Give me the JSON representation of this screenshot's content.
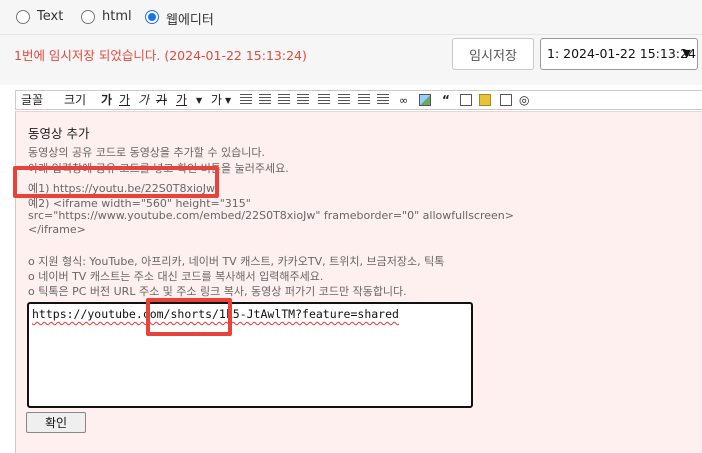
{
  "mode": {
    "options": [
      {
        "label": "Text",
        "checked": false
      },
      {
        "label": "html",
        "checked": false
      },
      {
        "label": "웹에디터",
        "checked": true
      }
    ]
  },
  "status": {
    "message": "1번에 임시저장 되었습니다. (2024-01-22 15:13:24)",
    "temp_save_label": "임시저장",
    "draft_selected": "1: 2024-01-22 15:13:24"
  },
  "toolbar": {
    "font_label": "글꼴",
    "size_label": "크기",
    "bold": "가",
    "underline": "가",
    "italic": "가",
    "strike": "가",
    "font_color": "가",
    "bg_color": "가",
    "quote": "“"
  },
  "panel": {
    "title": "동영상 추가",
    "help": [
      "동영상의 공유 코드로 동영상을 추가할 수 있습니다.",
      "아래 입력창에 공유 코드를 넣고 확인 버튼을 눌러주세요.",
      "예1) https://youtu.be/22S0T8xioJw",
      "예2) <iframe width=\"560\" height=\"315\"",
      "src=\"https://www.youtube.com/embed/22S0T8xioJw\" frameborder=\"0\" allowfullscreen>",
      "</iframe>",
      "o 지원 형식: YouTube, 아프리카, 네이버 TV 캐스트, 카카오TV, 트위치, 브금저장소, 틱톡",
      "o 네이버 TV 캐스트는 주소 대신 코드를 복사해서 입력해주세요.",
      "o 틱톡은 PC 버전 URL 주소 및 주소 링크 복사, 동영상 퍼가기 코드만 작동합니다."
    ],
    "code_value": "https://youtube.com/shorts/1k5-JtAwlTM?feature=shared",
    "confirm_label": "확인"
  },
  "colors": {
    "accent": "#1a73e8",
    "status_message": "#e14a3f",
    "panel_background": "#fdf0ee",
    "highlight": "#e8423a"
  },
  "icons": [
    "chevron-down-icon",
    "align-left-icon",
    "align-center-icon",
    "align-right-icon",
    "align-justify-icon",
    "outdent-icon",
    "indent-icon",
    "ordered-list-icon",
    "unordered-list-icon",
    "link-icon",
    "image-icon",
    "quote-icon",
    "save-icon",
    "media-icon",
    "box-icon",
    "source-icon"
  ]
}
